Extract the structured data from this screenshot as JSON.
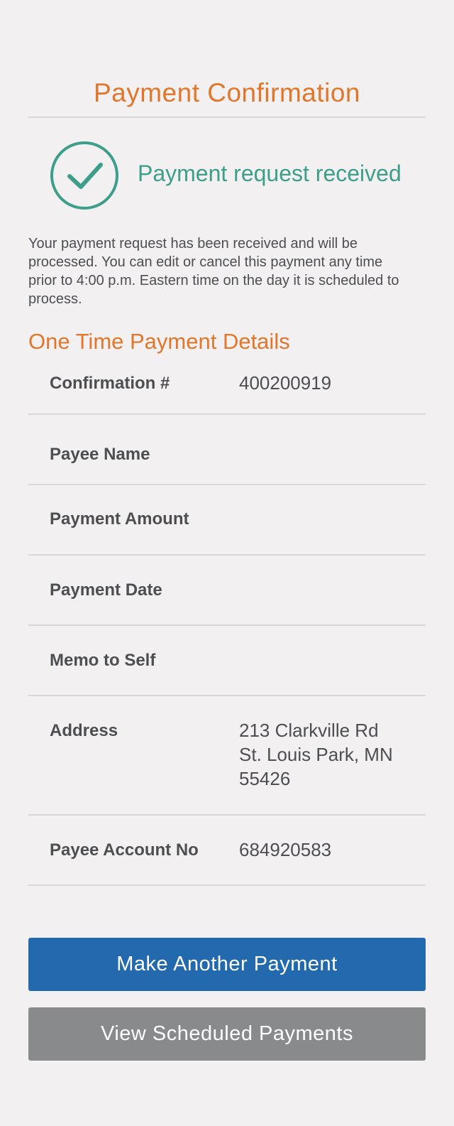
{
  "header": {
    "title": "Payment Confirmation"
  },
  "status": {
    "icon": "check-circle-icon",
    "text": "Payment request received",
    "color": "#3d9e8a"
  },
  "intro_text": "Your payment request has been received and will be processed.  You can edit or cancel this payment any time prior to 4:00 p.m. Eastern time on the day it is scheduled to process.",
  "details": {
    "section_title": "One Time Payment Details",
    "rows": [
      {
        "label": "Confirmation #",
        "value": "400200919"
      },
      {
        "label": "Payee Name",
        "value": ""
      },
      {
        "label": "Payment Amount",
        "value": ""
      },
      {
        "label": "Payment Date",
        "value": ""
      },
      {
        "label": "Memo to Self",
        "value": ""
      },
      {
        "label": "Address",
        "value_lines": [
          "213 Clarkville Rd",
          "St. Louis Park, MN",
          "55426"
        ]
      },
      {
        "label": "Payee Account No",
        "value": "684920583"
      }
    ]
  },
  "actions": {
    "primary_label": "Make Another Payment",
    "secondary_label": "View Scheduled Payments"
  },
  "colors": {
    "accent_orange": "#e2772b",
    "primary_blue": "#226aad",
    "secondary_gray": "#888a8c",
    "background": "#f2f0f1"
  }
}
